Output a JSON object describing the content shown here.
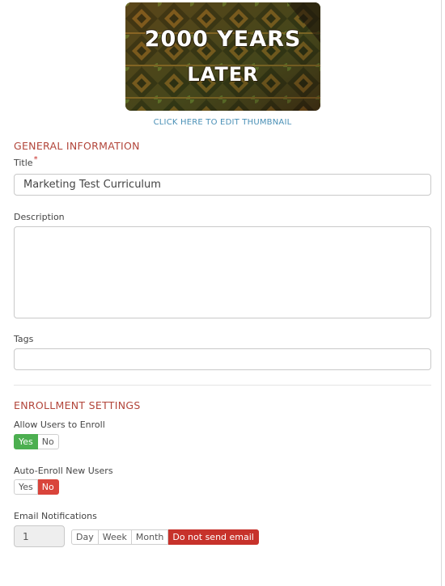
{
  "thumbnail": {
    "line1": "2000 YEARS",
    "line2": "LATER",
    "edit_link": "CLICK HERE TO EDIT THUMBNAIL"
  },
  "general": {
    "section_title": "GENERAL INFORMATION",
    "title_label": "Title",
    "required_marker": "*",
    "title_value": "Marketing Test Curriculum",
    "description_label": "Description",
    "description_value": "",
    "tags_label": "Tags",
    "tags_value": ""
  },
  "enrollment": {
    "section_title": "ENROLLMENT SETTINGS",
    "allow_enroll": {
      "label": "Allow Users to Enroll",
      "yes": "Yes",
      "no": "No",
      "selected": "Yes"
    },
    "auto_enroll": {
      "label": "Auto-Enroll New Users",
      "yes": "Yes",
      "no": "No",
      "selected": "No"
    },
    "email_notifications": {
      "label": "Email Notifications",
      "count_value": "1",
      "options": [
        "Day",
        "Week",
        "Month",
        "Do not send email"
      ],
      "selected": "Do not send email"
    }
  },
  "colors": {
    "section_title": "#b2453a",
    "link": "#4a90b6",
    "yes_active": "#4caf50",
    "no_active": "#d9443b",
    "do_not_send_active": "#c7322b"
  }
}
